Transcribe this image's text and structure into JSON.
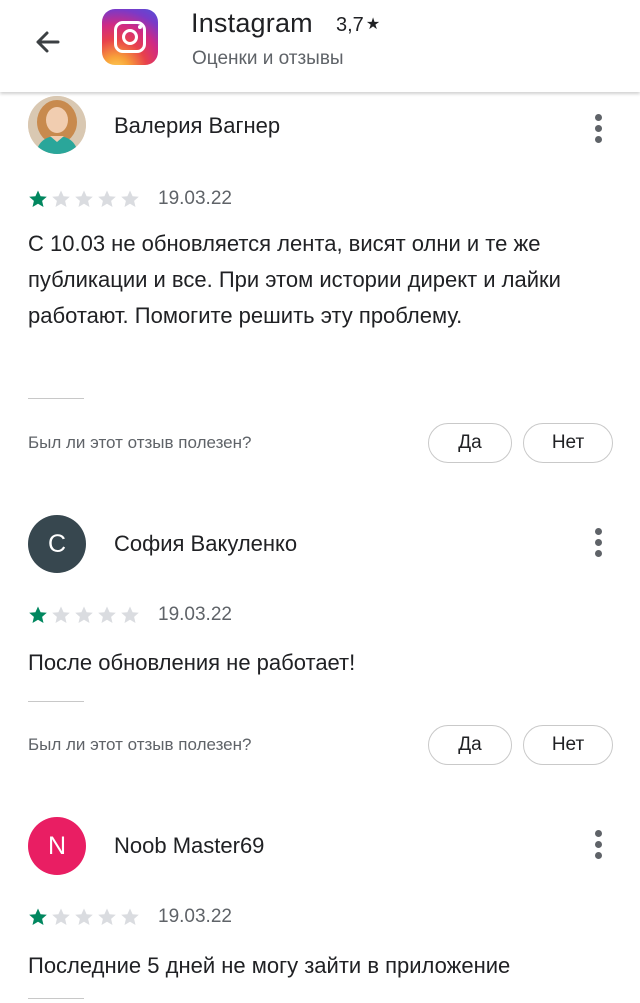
{
  "header": {
    "app_name": "Instagram",
    "rating": "3,7",
    "star": "★",
    "subtitle": "Оценки и отзывы"
  },
  "colors": {
    "star_filled": "#01875f",
    "star_empty": "#dadce0",
    "avatar_sofia": "#37474f",
    "avatar_noob": "#e91e63"
  },
  "icons": [
    "back-arrow-icon",
    "instagram-logo-icon",
    "more-vertical-icon",
    "star-icon"
  ],
  "reviews": [
    {
      "author": "Валерия Вагнер",
      "avatar_letter": "",
      "rating": 1,
      "date": "19.03.22",
      "text": "С 10.03 не обновляется лента, висят олни и те же публикации и все. При этом истории директ и лайки работают. Помогите решить эту проблему.",
      "helpful_question": "Был ли этот отзыв полезен?",
      "yes": "Да",
      "no": "Нет"
    },
    {
      "author": "София Вакуленко",
      "avatar_letter": "С",
      "rating": 1,
      "date": "19.03.22",
      "text": "После обновления не работает!",
      "helpful_question": "Был ли этот отзыв полезен?",
      "yes": "Да",
      "no": "Нет"
    },
    {
      "author": "Noob Master69",
      "avatar_letter": "N",
      "rating": 1,
      "date": "19.03.22",
      "text": "Последние 5 дней не могу зайти в приложение"
    }
  ]
}
